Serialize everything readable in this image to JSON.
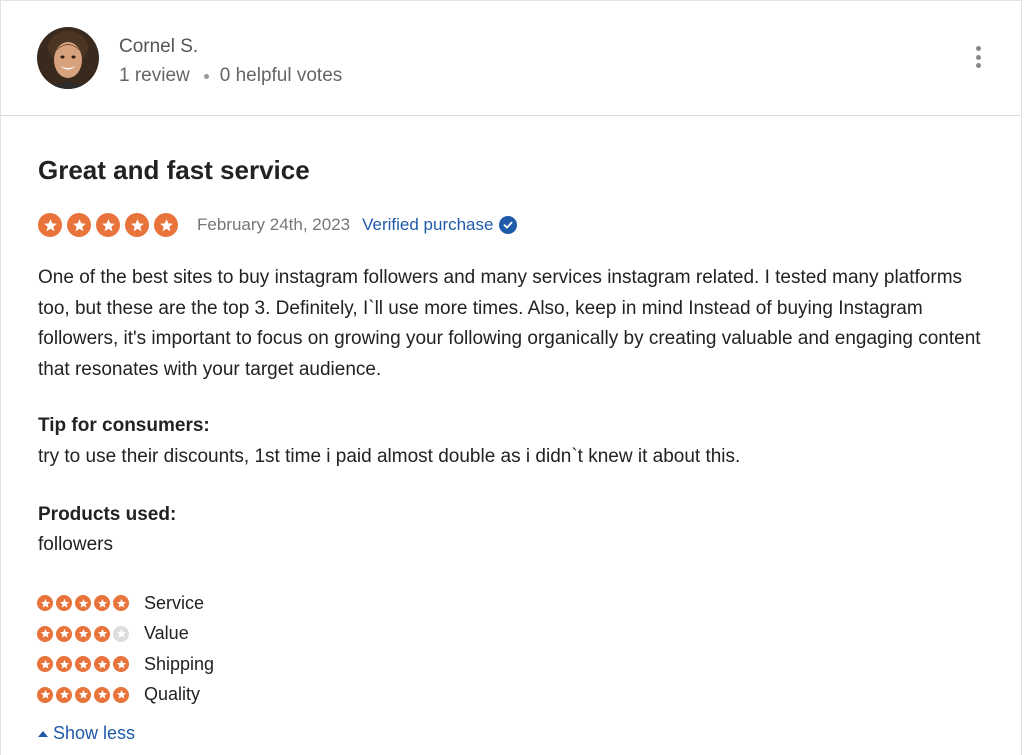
{
  "reviewer": {
    "name": "Cornel S.",
    "review_count": "1 review",
    "helpful_votes": "0 helpful votes"
  },
  "review": {
    "title": "Great and fast service",
    "rating": 5,
    "max_rating": 5,
    "date": "February 24th, 2023",
    "verified_label": "Verified purchase",
    "body": "One of the best sites to buy instagram followers and many services instagram related. I tested many platforms too, but these are the top 3. Definitely, I`ll use more times. Also, keep in mind Instead of buying Instagram followers, it's important to focus on growing your following organically by creating valuable and engaging content that resonates with your target audience.",
    "tip_label": "Tip for consumers:",
    "tip_text": "try to use their discounts, 1st time i paid almost double as i didn`t knew it about this.",
    "products_label": "Products used:",
    "products_text": "followers",
    "sub_ratings": [
      {
        "label": "Service",
        "rating": 5
      },
      {
        "label": "Value",
        "rating": 4
      },
      {
        "label": "Shipping",
        "rating": 5
      },
      {
        "label": "Quality",
        "rating": 5
      }
    ],
    "show_less_label": "Show less"
  },
  "colors": {
    "star_filled": "#e8743b",
    "star_empty": "#dddddd",
    "link": "#1f5ba8"
  },
  "icons": {
    "menu": "vertical-dots-icon",
    "verified": "check-circle-icon",
    "star": "star-icon",
    "collapse": "caret-up-icon"
  }
}
